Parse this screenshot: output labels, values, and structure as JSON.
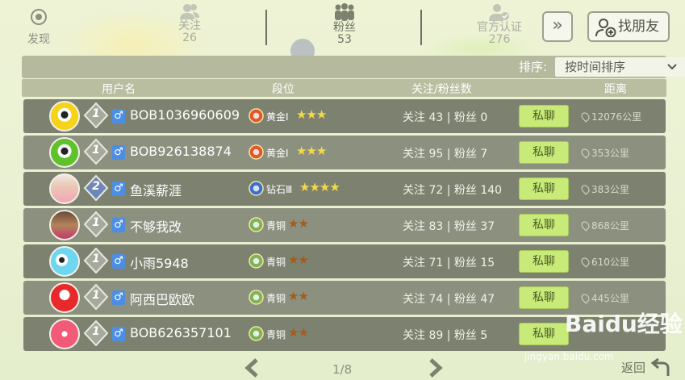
{
  "nav": {
    "discover": "发现",
    "tabs": [
      {
        "label": "关注",
        "count": "26"
      },
      {
        "label": "粉丝",
        "count": "53"
      },
      {
        "label": "官方认证",
        "count": "276"
      }
    ],
    "more_symbol": "»",
    "find_friend": "找朋友"
  },
  "sort": {
    "label": "排序:",
    "value": "按时间排序"
  },
  "columns": {
    "username": "用户名",
    "rank": "段位",
    "follow_fans": "关注/粉丝数",
    "distance": "距离"
  },
  "rows": [
    {
      "level": "1",
      "name": "BOB1036960609",
      "rank": "黄金Ⅰ",
      "stars": "★★★",
      "follow": "关注 43",
      "fans": "粉丝 0",
      "chat": "私聊",
      "distance": "12076公里"
    },
    {
      "level": "1",
      "name": "BOB926138874",
      "rank": "黄金Ⅰ",
      "stars": "★★★",
      "follow": "关注 95",
      "fans": "粉丝 7",
      "chat": "私聊",
      "distance": "353公里"
    },
    {
      "level": "2",
      "name": "鱼溪薪涯",
      "rank": "钻石Ⅲ",
      "stars": "★★★★",
      "follow": "关注 72",
      "fans": "粉丝 140",
      "chat": "私聊",
      "distance": "383公里"
    },
    {
      "level": "1",
      "name": "不够我改",
      "rank": "青铜",
      "stars": "★★",
      "follow": "关注 83",
      "fans": "粉丝 37",
      "chat": "私聊",
      "distance": "868公里"
    },
    {
      "level": "1",
      "name": "小雨5948",
      "rank": "青铜",
      "stars": "★★",
      "follow": "关注 71",
      "fans": "粉丝 15",
      "chat": "私聊",
      "distance": "610公里"
    },
    {
      "level": "1",
      "name": "阿西巴欧欧",
      "rank": "青铜",
      "stars": "★★",
      "follow": "关注 74",
      "fans": "粉丝 47",
      "chat": "私聊",
      "distance": "445公里"
    },
    {
      "level": "1",
      "name": "BOB626357101",
      "rank": "青铜",
      "stars": "★★",
      "follow": "关注 89",
      "fans": "粉丝 5",
      "chat": "私聊",
      "distance": ""
    }
  ],
  "pager": {
    "text": "1/8",
    "back": "返回"
  },
  "watermark": {
    "brand": "Baidu经验",
    "url": "jingyan.baidu.com"
  },
  "colors": {
    "accent": "#c8ea78",
    "row_dark": "#7d8270",
    "row_light": "#8c907f",
    "gender": "#4c8ee6"
  }
}
